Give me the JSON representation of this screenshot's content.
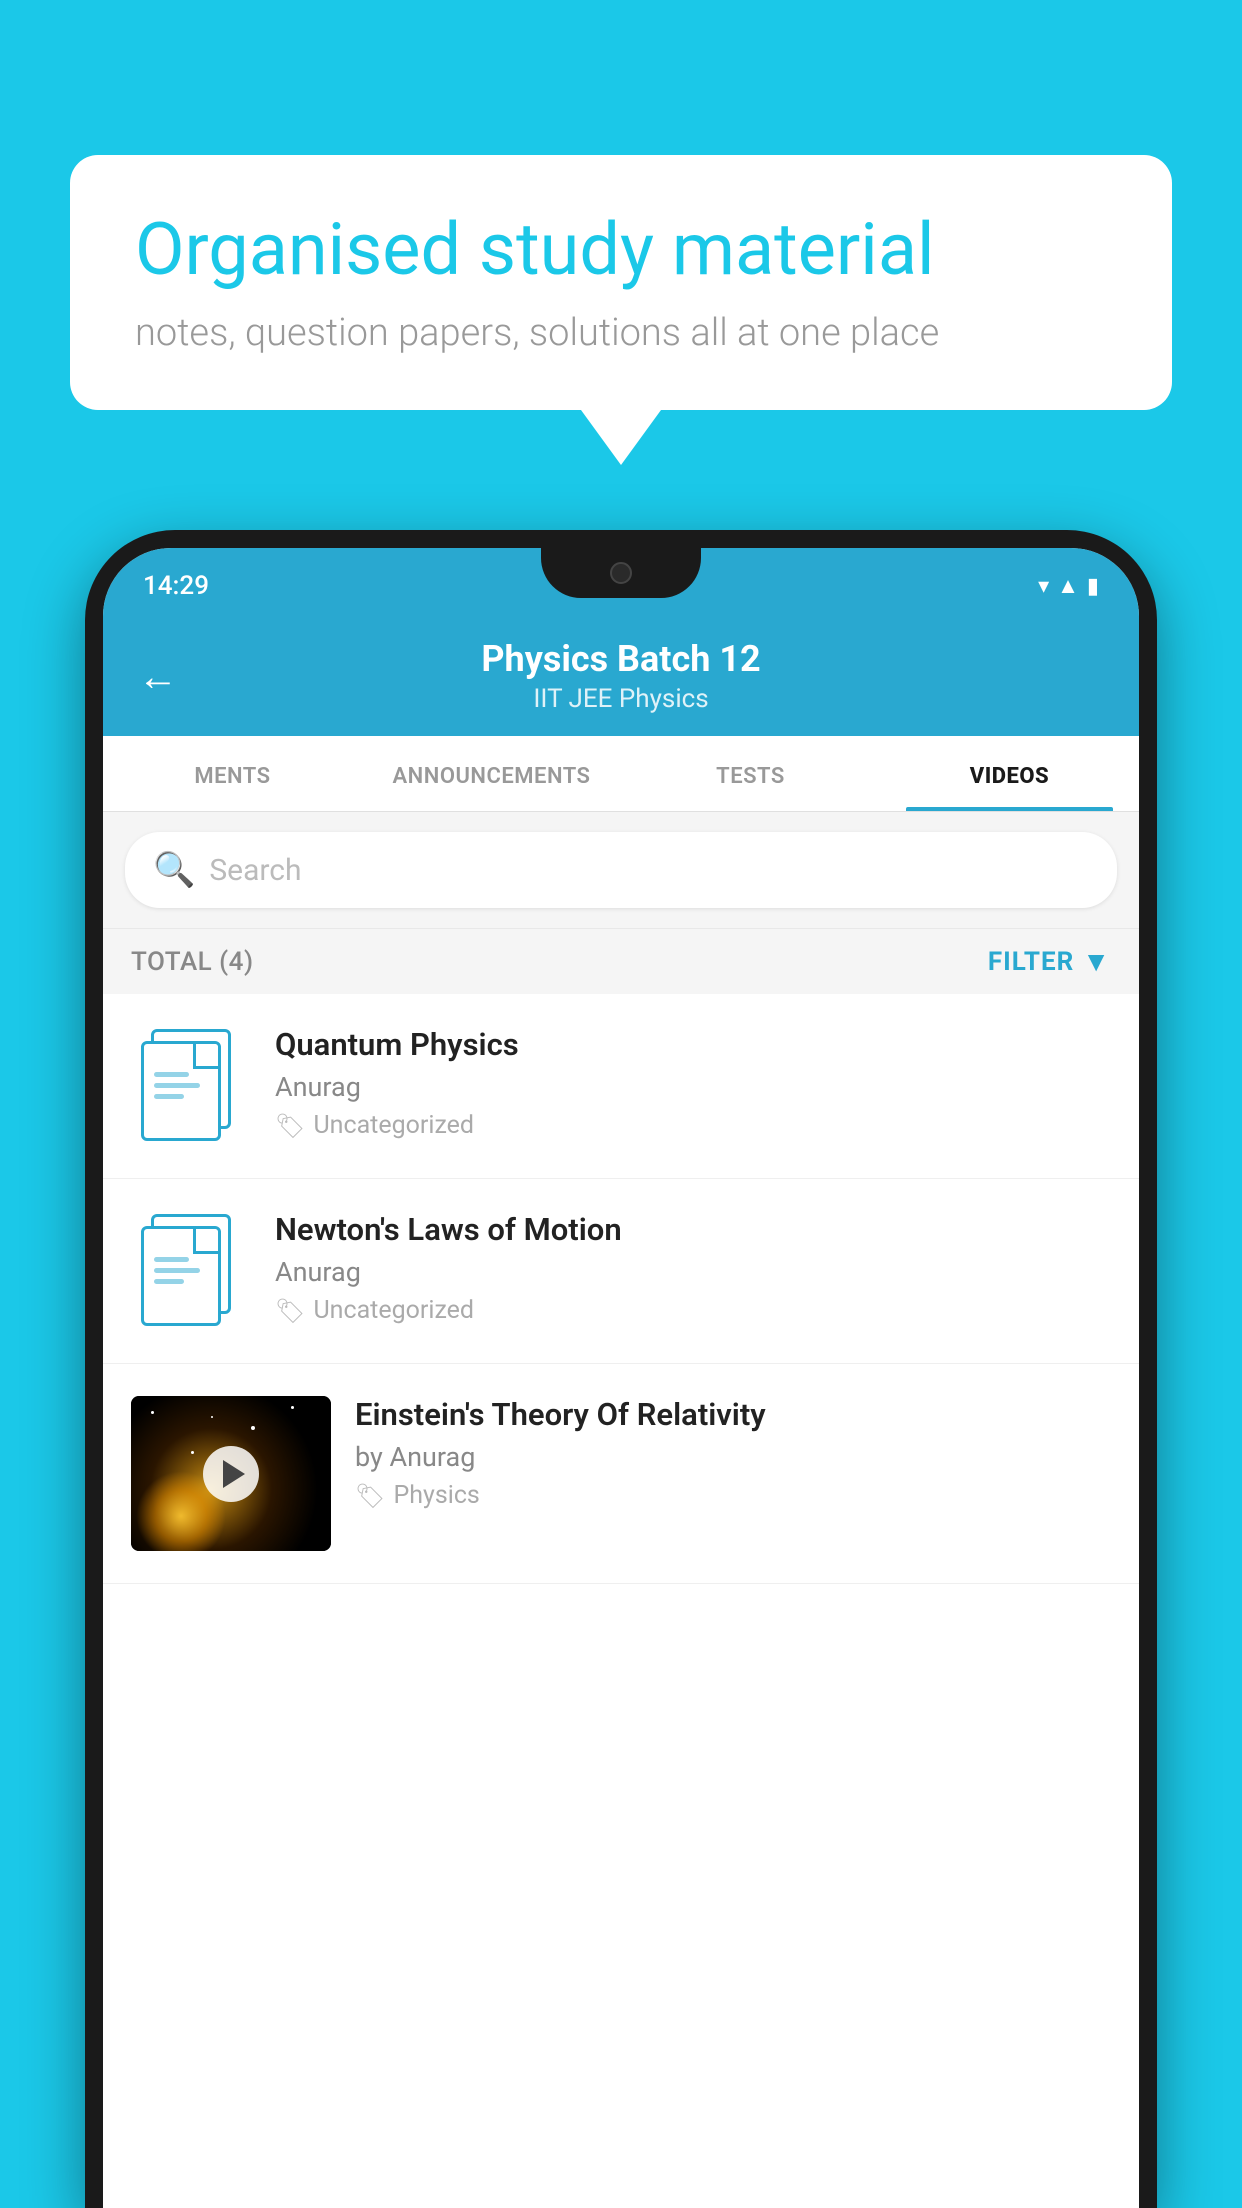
{
  "background_color": "#1BC8E8",
  "speech_bubble": {
    "title": "Organised study material",
    "subtitle": "notes, question papers, solutions all at one place"
  },
  "app": {
    "header": {
      "title": "Physics Batch 12",
      "subtitle": "IIT JEE    Physics",
      "back_label": "←"
    },
    "tabs": [
      {
        "label": "MENTS",
        "active": false
      },
      {
        "label": "ANNOUNCEMENTS",
        "active": false
      },
      {
        "label": "TESTS",
        "active": false
      },
      {
        "label": "VIDEOS",
        "active": true
      }
    ],
    "search": {
      "placeholder": "Search"
    },
    "filter_bar": {
      "total_label": "TOTAL (4)",
      "filter_label": "FILTER"
    },
    "video_list": [
      {
        "id": 1,
        "title": "Quantum Physics",
        "author": "Anurag",
        "tag": "Uncategorized",
        "type": "document"
      },
      {
        "id": 2,
        "title": "Newton's Laws of Motion",
        "author": "Anurag",
        "tag": "Uncategorized",
        "type": "document"
      },
      {
        "id": 3,
        "title": "Einstein's Theory Of Relativity",
        "author": "by Anurag",
        "tag": "Physics",
        "type": "video"
      }
    ]
  },
  "status_bar": {
    "time": "14:29"
  }
}
